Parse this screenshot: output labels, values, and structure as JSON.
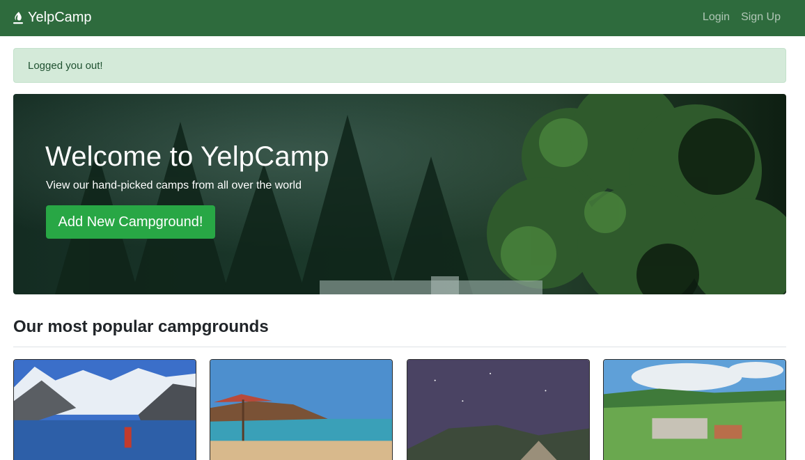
{
  "navbar": {
    "brand": "YelpCamp",
    "links": [
      "Login",
      "Sign Up"
    ]
  },
  "alert": {
    "message": "Logged you out!"
  },
  "hero": {
    "title": "Welcome to YelpCamp",
    "subtitle": "View our hand-picked camps from all over the world",
    "button_label": "Add New Campground!"
  },
  "section": {
    "title": "Our most popular campgrounds"
  },
  "cards": [
    {
      "image": "mountain-lake"
    },
    {
      "image": "beach-umbrella"
    },
    {
      "image": "night-sky-tent"
    },
    {
      "image": "village-valley"
    }
  ],
  "colors": {
    "navbar": "#2e6b3d",
    "alert_bg": "#d4ead9",
    "button": "#28a745"
  }
}
